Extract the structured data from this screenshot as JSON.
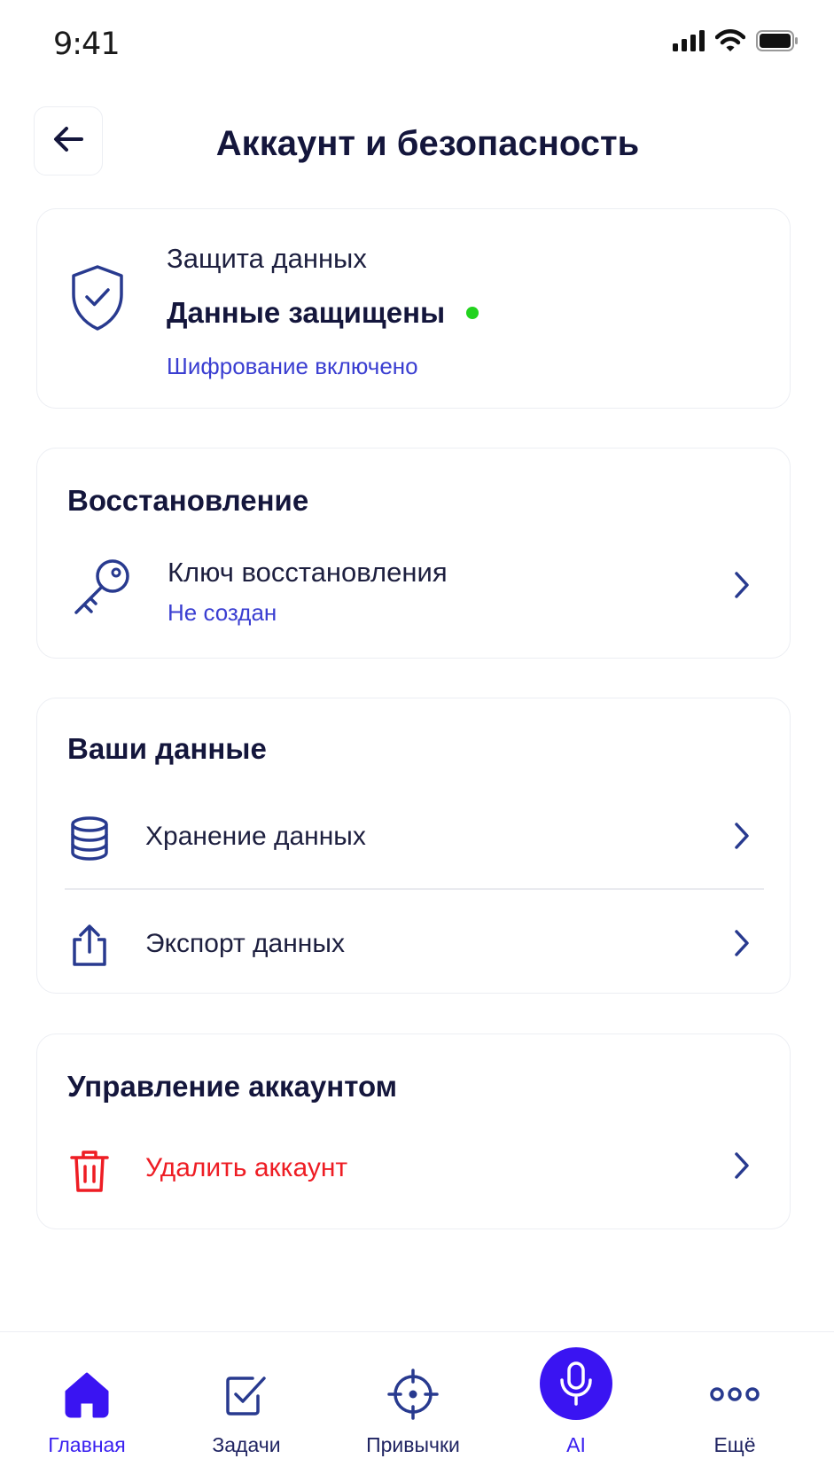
{
  "status_bar": {
    "time": "9:41"
  },
  "header": {
    "title": "Аккаунт и безопасность"
  },
  "protection": {
    "label": "Защита данных",
    "status": "Данные защищены",
    "subtitle": "Шифрование включено",
    "status_color": "#22d31e"
  },
  "recovery": {
    "title": "Восстановление",
    "item": {
      "label": "Ключ восстановления",
      "sublabel": "Не создан"
    }
  },
  "your_data": {
    "title": "Ваши данные",
    "items": [
      {
        "label": "Хранение данных",
        "icon": "database-icon"
      },
      {
        "label": "Экспорт данных",
        "icon": "share-icon"
      }
    ]
  },
  "account_management": {
    "title": "Управление аккаунтом",
    "delete_label": "Удалить аккаунт",
    "delete_color": "#ee1d24"
  },
  "tab_bar": {
    "tabs": [
      {
        "label": "Главная",
        "icon": "home-icon",
        "active": true
      },
      {
        "label": "Задачи",
        "icon": "checkbox-icon",
        "active": false
      },
      {
        "label": "Привычки",
        "icon": "target-icon",
        "active": false
      },
      {
        "label": "AI",
        "icon": "microphone-icon",
        "active": false
      },
      {
        "label": "Ещё",
        "icon": "more-icon",
        "active": false
      }
    ]
  },
  "colors": {
    "accent": "#3a14f2",
    "text": "#14163c",
    "link": "#3a3ed1",
    "danger": "#ee1d24"
  }
}
